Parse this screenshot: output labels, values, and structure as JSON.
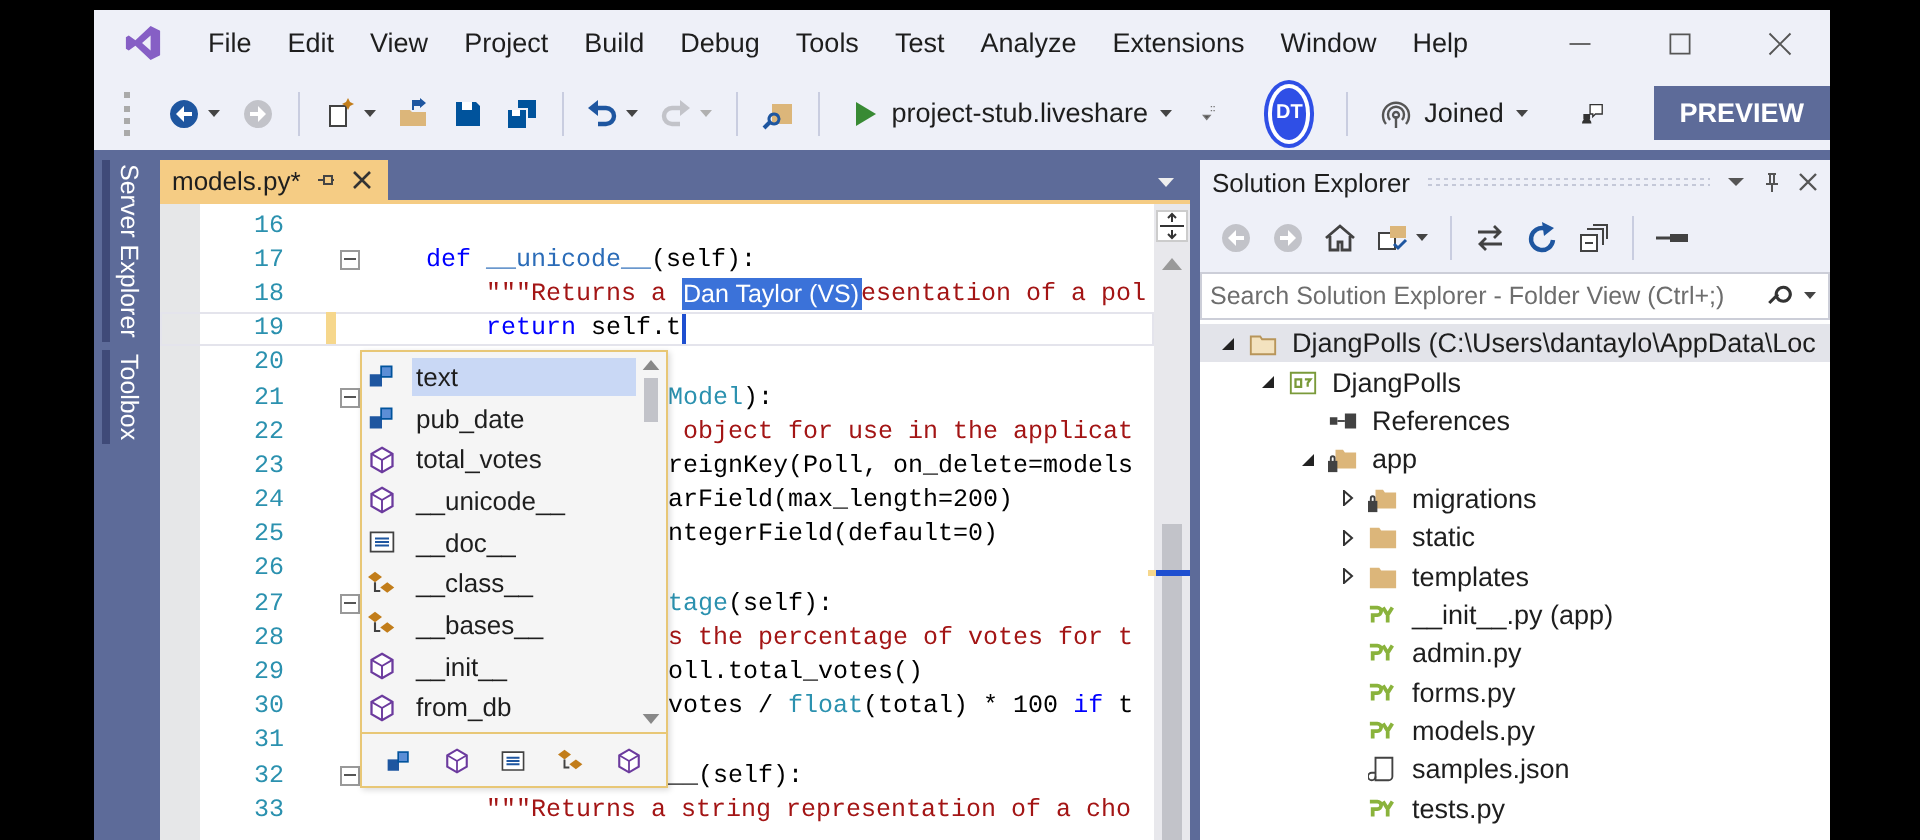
{
  "menu": [
    "File",
    "Edit",
    "View",
    "Project",
    "Build",
    "Debug",
    "Tools",
    "Test",
    "Analyze",
    "Extensions",
    "Window",
    "Help"
  ],
  "toolbar": {
    "groups": [
      [
        {
          "kind": "back",
          "disabled": false,
          "dropdown": true
        },
        {
          "kind": "forward",
          "disabled": true,
          "dropdown": false
        }
      ],
      [
        {
          "kind": "new-project",
          "disabled": false,
          "dropdown": true
        },
        {
          "kind": "open",
          "disabled": false,
          "dropdown": false
        },
        {
          "kind": "save",
          "disabled": false,
          "dropdown": false
        },
        {
          "kind": "save-all",
          "disabled": false,
          "dropdown": false
        }
      ],
      [
        {
          "kind": "undo",
          "disabled": false,
          "dropdown": true
        },
        {
          "kind": "redo",
          "disabled": true,
          "dropdown": true
        }
      ],
      [
        {
          "kind": "find",
          "disabled": false,
          "dropdown": false
        }
      ]
    ],
    "run_target": "project-stub.liveshare",
    "avatar": "DT",
    "session": "Joined",
    "preview_button": "PREVIEW"
  },
  "side_tabs": [
    "Server Explorer",
    "Toolbox"
  ],
  "document_tabs": [
    {
      "label": "models.py*",
      "selected": true
    }
  ],
  "editor": {
    "lines": [
      {
        "number": "16",
        "current": false,
        "modified": false,
        "fold_marker": false,
        "clipped": false
      },
      {
        "number": "17",
        "current": false,
        "modified": false,
        "fold_marker": true,
        "clipped": false,
        "segments": [
          {
            "kind": "keyword",
            "text": "    def "
          },
          {
            "kind": "function",
            "text": "__unicode__"
          },
          {
            "kind": "plain",
            "text": "(self):"
          }
        ]
      },
      {
        "number": "18",
        "current": false,
        "modified": false,
        "fold_marker": false,
        "clipped": false,
        "segments": [
          {
            "kind": "string",
            "text": "        \"\"\"Returns a "
          },
          {
            "kind": "author_flag",
            "text": "Dan Taylor (VS)"
          },
          {
            "kind": "string",
            "text": "esentation of a pol"
          }
        ]
      },
      {
        "number": "19",
        "current": true,
        "modified": true,
        "fold_marker": false,
        "clipped": false,
        "segments": [
          {
            "kind": "keyword",
            "text": "        return"
          },
          {
            "kind": "plain",
            "text": " self.t"
          }
        ]
      },
      {
        "number": "20",
        "current": false,
        "modified": false,
        "fold_marker": false
      },
      {
        "number": "21",
        "current": false,
        "modified": false,
        "fold_marker": true,
        "clipped": true,
        "segments": [
          {
            "kind": "type",
            "text": "Model"
          },
          {
            "kind": "plain",
            "text": "):"
          }
        ]
      },
      {
        "number": "22",
        "current": false,
        "modified": false,
        "fold_marker": false,
        "clipped": true,
        "segments": [
          {
            "kind": "string",
            "text": " object for use in the applicat"
          }
        ]
      },
      {
        "number": "23",
        "current": false,
        "modified": false,
        "fold_marker": false,
        "clipped": true,
        "segments": [
          {
            "kind": "plain",
            "text": "reignKey(Poll, on_delete=models"
          }
        ]
      },
      {
        "number": "24",
        "current": false,
        "modified": false,
        "fold_marker": false,
        "clipped": true,
        "segments": [
          {
            "kind": "plain",
            "text": "arField(max_length=200)"
          }
        ]
      },
      {
        "number": "25",
        "current": false,
        "modified": false,
        "fold_marker": false,
        "clipped": true,
        "segments": [
          {
            "kind": "plain",
            "text": "ntegerField(default=0)"
          }
        ]
      },
      {
        "number": "26",
        "current": false,
        "modified": false,
        "fold_marker": false
      },
      {
        "number": "27",
        "current": false,
        "modified": false,
        "fold_marker": true,
        "clipped": true,
        "segments": [
          {
            "kind": "type",
            "text": "tage"
          },
          {
            "kind": "plain",
            "text": "(self):"
          }
        ]
      },
      {
        "number": "28",
        "current": false,
        "modified": false,
        "fold_marker": false,
        "clipped": true,
        "segments": [
          {
            "kind": "string",
            "text": "s the percentage of votes for t"
          }
        ]
      },
      {
        "number": "29",
        "current": false,
        "modified": false,
        "fold_marker": false,
        "clipped": true,
        "segments": [
          {
            "kind": "plain",
            "text": "oll.total_votes()"
          }
        ]
      },
      {
        "number": "30",
        "current": false,
        "modified": false,
        "fold_marker": false,
        "clipped": true,
        "segments": [
          {
            "kind": "plain",
            "text": "votes / "
          },
          {
            "kind": "type",
            "text": "float"
          },
          {
            "kind": "plain",
            "text": "(total) * 100 "
          },
          {
            "kind": "keyword",
            "text": "if"
          },
          {
            "kind": "plain",
            "text": " t"
          }
        ]
      },
      {
        "number": "31",
        "current": false,
        "modified": false,
        "fold_marker": false
      },
      {
        "number": "32",
        "current": false,
        "modified": false,
        "fold_marker": true,
        "clipped": true,
        "segments": [
          {
            "kind": "plain",
            "text": "__(self):"
          }
        ]
      },
      {
        "number": "33",
        "current": false,
        "modified": false,
        "fold_marker": false,
        "clipped": false,
        "segments": [
          {
            "kind": "string",
            "text": "        \"\"\"Returns a string representation of a cho"
          }
        ]
      }
    ],
    "completion": {
      "items": [
        {
          "label": "text",
          "kind": "field",
          "selected": true
        },
        {
          "label": "pub_date",
          "kind": "field",
          "selected": false
        },
        {
          "label": "total_votes",
          "kind": "method",
          "selected": false
        },
        {
          "label": "__unicode__",
          "kind": "method",
          "selected": false
        },
        {
          "label": "__doc__",
          "kind": "doc",
          "selected": false
        },
        {
          "label": "__class__",
          "kind": "class",
          "selected": false
        },
        {
          "label": "__bases__",
          "kind": "class",
          "selected": false
        },
        {
          "label": "__init__",
          "kind": "method",
          "selected": false
        },
        {
          "label": "from_db",
          "kind": "method",
          "selected": false
        }
      ],
      "filters": [
        {
          "kind": "field"
        },
        {
          "kind": "method"
        },
        {
          "kind": "doc"
        },
        {
          "kind": "class"
        },
        {
          "kind": "method"
        }
      ]
    }
  },
  "solution_explorer": {
    "title": "Solution Explorer",
    "toolbar": [
      [
        {
          "kind": "back",
          "disabled": true,
          "dropdown": false
        },
        {
          "kind": "forward",
          "disabled": true,
          "dropdown": false
        },
        {
          "kind": "home",
          "disabled": false,
          "dropdown": false
        },
        {
          "kind": "switch-views",
          "disabled": false,
          "dropdown": true
        }
      ],
      [
        {
          "kind": "sync",
          "disabled": false,
          "dropdown": false
        },
        {
          "kind": "refresh",
          "disabled": false,
          "dropdown": false
        },
        {
          "kind": "collapse",
          "disabled": false,
          "dropdown": false
        }
      ],
      [
        {
          "kind": "properties",
          "disabled": false,
          "dropdown": false
        }
      ]
    ],
    "search": {
      "placeholder": "Search Solution Explorer - Folder View (Ctrl+;)"
    },
    "tree": [
      {
        "label": "DjangPolls (C:\\Users\\dantaylo\\AppData\\Loc",
        "kind": "solution",
        "expanded": true,
        "selected": true,
        "children": [
          {
            "label": "DjangPolls",
            "kind": "python-project",
            "expanded": true,
            "selected": false,
            "children": [
              {
                "label": "References",
                "kind": "references",
                "selected": false
              },
              {
                "label": "app",
                "kind": "package",
                "expanded": true,
                "selected": false,
                "children": [
                  {
                    "label": "migrations",
                    "kind": "package",
                    "expanded": false,
                    "selected": false
                  },
                  {
                    "label": "static",
                    "kind": "folder",
                    "expanded": false,
                    "selected": false
                  },
                  {
                    "label": "templates",
                    "kind": "folder",
                    "expanded": false,
                    "selected": false
                  },
                  {
                    "label": "__init__.py (app)",
                    "kind": "python-file",
                    "selected": false
                  },
                  {
                    "label": "admin.py",
                    "kind": "python-file",
                    "selected": false
                  },
                  {
                    "label": "forms.py",
                    "kind": "python-file",
                    "selected": false
                  },
                  {
                    "label": "models.py",
                    "kind": "python-file",
                    "selected": false
                  },
                  {
                    "label": "samples.json",
                    "kind": "json-file",
                    "selected": false
                  },
                  {
                    "label": "tests.py",
                    "kind": "python-file",
                    "selected": false
                  }
                ]
              }
            ]
          }
        ]
      }
    ]
  }
}
